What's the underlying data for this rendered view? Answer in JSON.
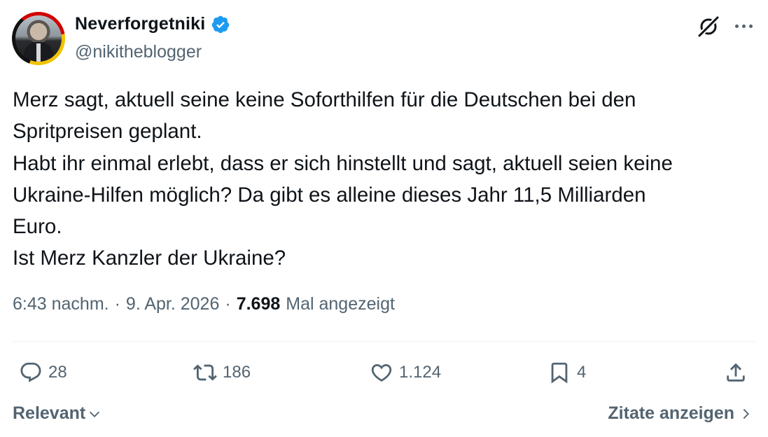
{
  "author": {
    "display_name": "Neverforgetniki",
    "handle": "@nikitheblogger",
    "verified": true,
    "verified_color": "#1d9bf0"
  },
  "post": {
    "lines": [
      "Merz sagt, aktuell seine keine Soforthilfen für die Deutschen bei den",
      "Spritpreisen geplant.",
      "Habt ihr einmal erlebt, dass er sich hinstellt und sagt, aktuell seien keine",
      "Ukraine-Hilfen möglich? Da gibt es alleine dieses Jahr 11,5 Milliarden",
      "Euro.",
      "Ist Merz Kanzler der Ukraine?"
    ]
  },
  "meta": {
    "time": "6:43 nachm.",
    "separator": "·",
    "date": "9. Apr. 2026",
    "views": "7.698",
    "views_label": "Mal angezeigt"
  },
  "actions": {
    "replies": "28",
    "reposts": "186",
    "likes": "1.124",
    "bookmarks": "4"
  },
  "footer": {
    "sort_label": "Relevant",
    "quotes_label": "Zitate anzeigen"
  },
  "icons": {
    "header": [
      "grok-icon",
      "more-icon"
    ],
    "actions": [
      "reply-icon",
      "repost-icon",
      "like-icon",
      "bookmark-icon",
      "share-icon"
    ],
    "footer": [
      "chevron-down-icon",
      "chevron-right-icon"
    ]
  },
  "colors": {
    "text": "#0f1419",
    "secondary": "#536471",
    "divider": "#eff3f4"
  }
}
